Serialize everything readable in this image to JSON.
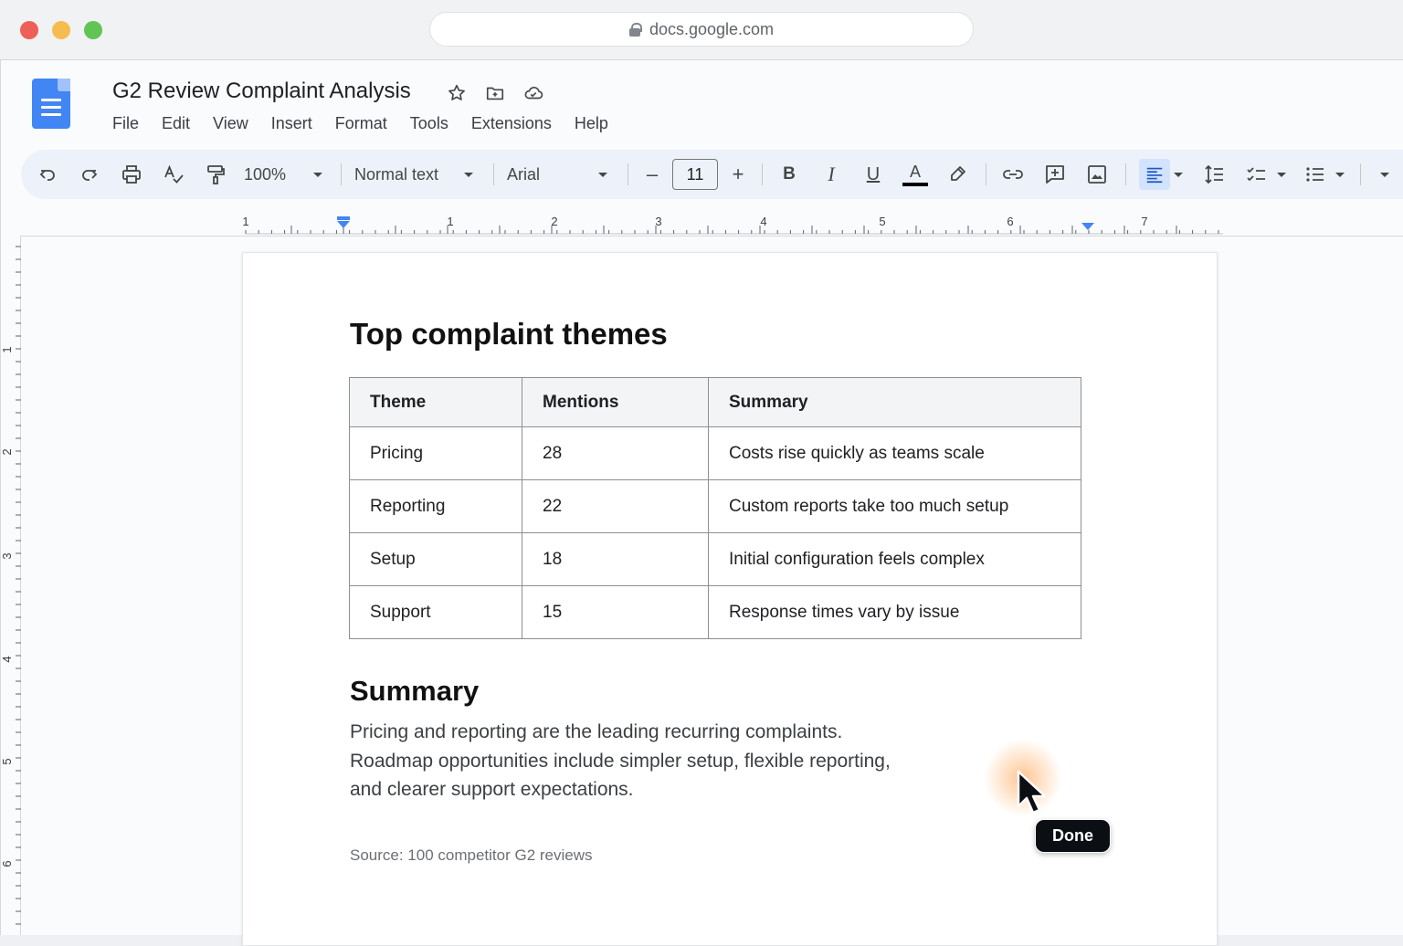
{
  "browser": {
    "url": "docs.google.com"
  },
  "app": {
    "doc_title": "G2 Review Complaint Analysis",
    "menu": [
      "File",
      "Edit",
      "View",
      "Insert",
      "Format",
      "Tools",
      "Extensions",
      "Help"
    ]
  },
  "toolbar": {
    "zoom": "100%",
    "style": "Normal text",
    "font": "Arial",
    "font_size": "11",
    "minus": "–",
    "plus": "+",
    "bold": "B",
    "italic": "I",
    "underline": "U",
    "text_color_glyph": "A"
  },
  "ruler": {
    "h_labels": [
      "1",
      "1",
      "2",
      "3",
      "4",
      "5",
      "6",
      "7"
    ],
    "v_labels": [
      "1",
      "2",
      "3",
      "4",
      "5",
      "6"
    ]
  },
  "document": {
    "heading": "Top complaint themes",
    "table": {
      "headers": [
        "Theme",
        "Mentions",
        "Summary"
      ],
      "rows": [
        [
          "Pricing",
          "28",
          "Costs rise quickly as teams scale"
        ],
        [
          "Reporting",
          "22",
          "Custom reports take too much setup"
        ],
        [
          "Setup",
          "18",
          "Initial configuration feels complex"
        ],
        [
          "Support",
          "15",
          "Response times vary by issue"
        ]
      ]
    },
    "summary_heading": "Summary",
    "summary_lines": [
      "Pricing and reporting are the leading recurring complaints.",
      "Roadmap opportunities include simpler setup, flexible reporting,",
      "and clearer support expectations."
    ],
    "source": "Source: 100 competitor G2 reviews"
  },
  "overlay": {
    "tooltip": "Done"
  },
  "colors": {
    "accent": "#4285f4",
    "toolbar_bg": "#edf2fa",
    "cursor_glow": "#ff963c"
  }
}
